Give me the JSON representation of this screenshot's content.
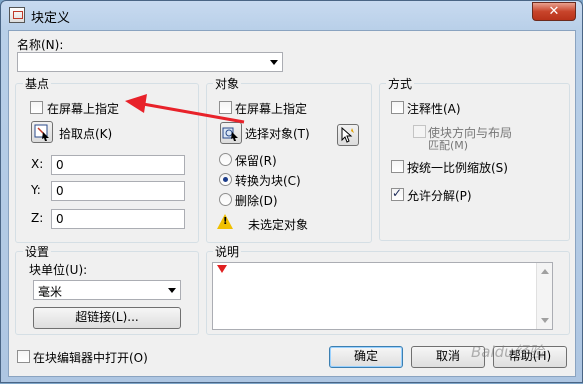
{
  "window": {
    "title": "块定义",
    "close_glyph": "✕"
  },
  "name_label": "名称(N):",
  "name_value": "",
  "basepoint": {
    "title": "基点",
    "onscreen": "在屏幕上指定",
    "pick_label": "拾取点(K)",
    "x_label": "X:",
    "x_value": "0",
    "y_label": "Y:",
    "y_value": "0",
    "z_label": "Z:",
    "z_value": "0"
  },
  "objects": {
    "title": "对象",
    "onscreen": "在屏幕上指定",
    "select_label": "选择对象(T)",
    "retain": "保留(R)",
    "convert": "转换为块(C)",
    "delete": "删除(D)",
    "none_selected": "未选定对象"
  },
  "behavior": {
    "title": "方式",
    "annotative": "注释性(A)",
    "match_line1": "使块方向与布局",
    "match_line2": "匹配(M)",
    "uniform": "按统一比例缩放(S)",
    "explode": "允许分解(P)"
  },
  "settings": {
    "title": "设置",
    "unit_label": "块单位(U):",
    "unit_value": "毫米",
    "hyperlink": "超链接(L)..."
  },
  "description": {
    "title": "说明",
    "text": ""
  },
  "footer": {
    "open_in_editor": "在块编辑器中打开(O)",
    "ok": "确定",
    "cancel": "取消",
    "help": "帮助(H)"
  },
  "state": {
    "basepoint_onscreen": false,
    "objects_onscreen": false,
    "radio_selected": "convert",
    "annotative": false,
    "match_layout": false,
    "uniform": false,
    "explode": true,
    "open_in_editor": false
  },
  "watermark": "Baidu经验",
  "colors": {
    "arrow": "#e8222a",
    "title_bar": "#b8cfe8",
    "close": "#c8442b",
    "warning": "#f0c000"
  }
}
